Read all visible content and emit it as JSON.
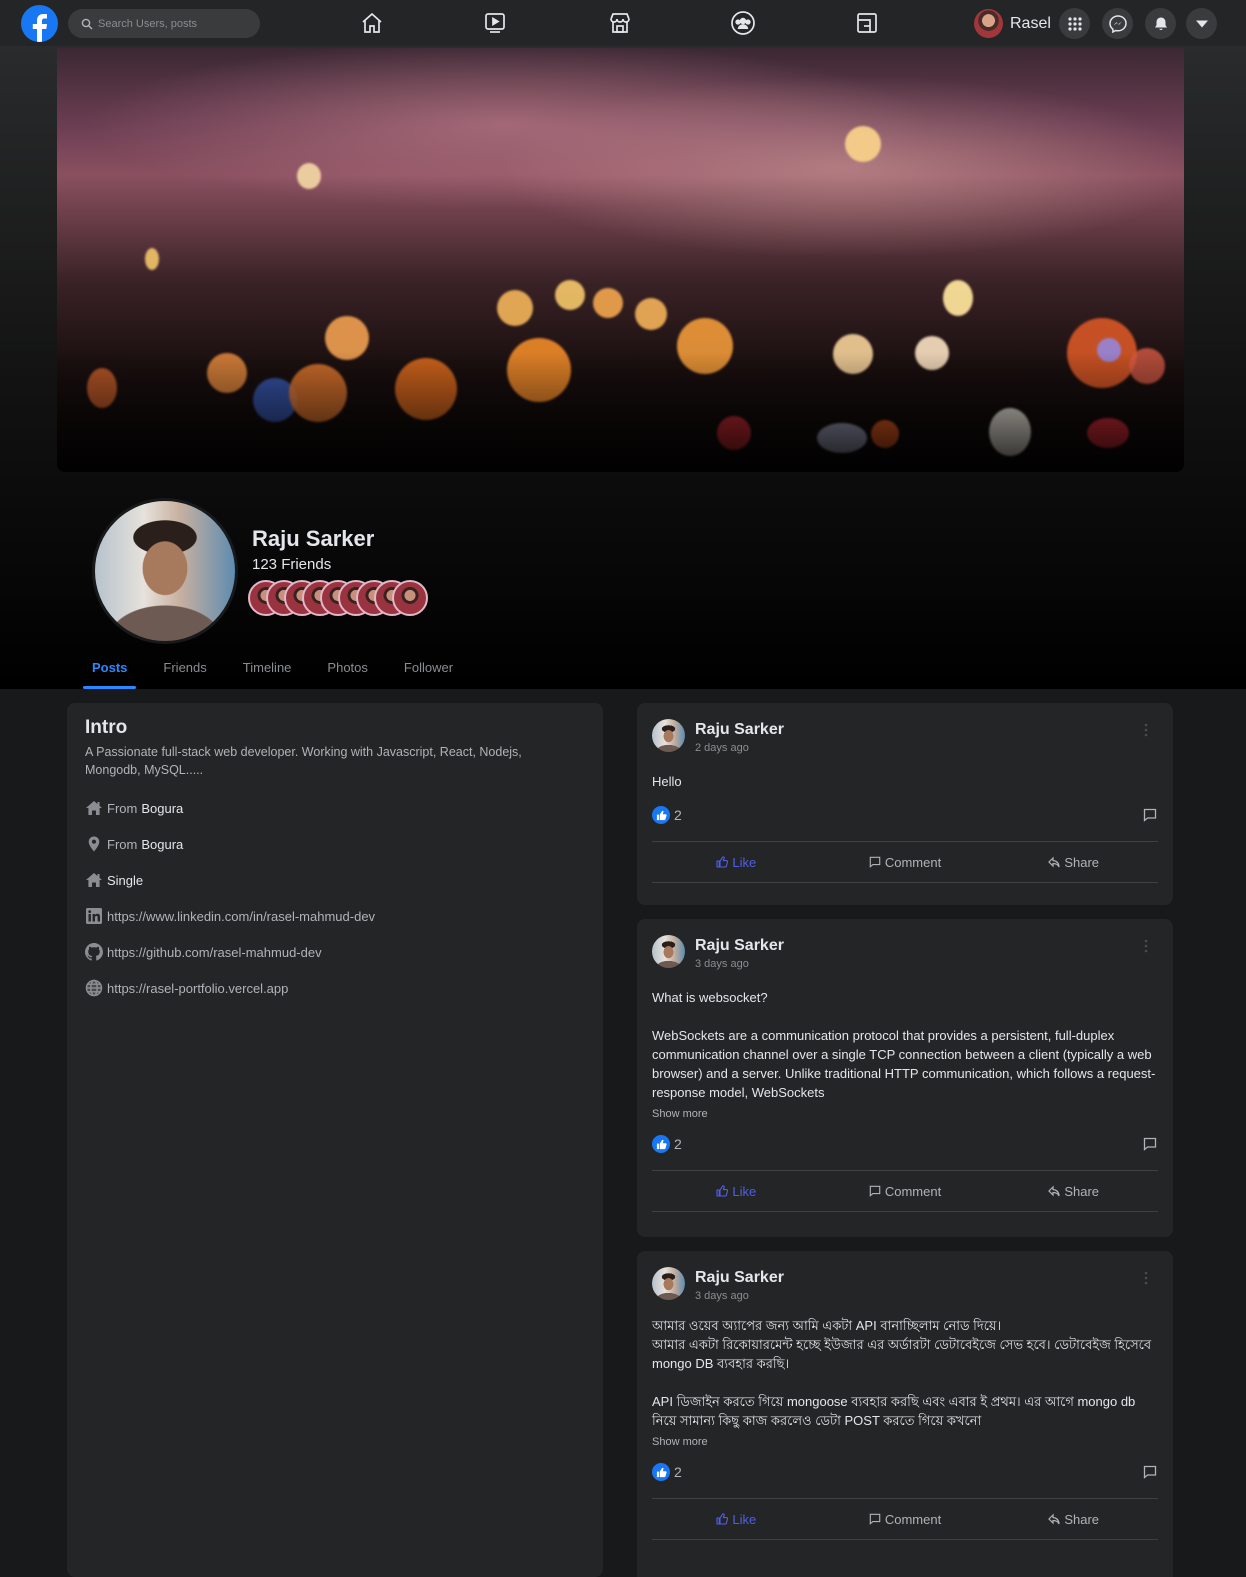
{
  "nav": {
    "search_placeholder": "Search Users, posts",
    "user_name": "Rasel"
  },
  "profile": {
    "name": "Raju Sarker",
    "friends_label": "123 Friends",
    "tabs": [
      "Posts",
      "Friends",
      "Timeline",
      "Photos",
      "Follower"
    ]
  },
  "intro": {
    "title": "Intro",
    "bio": "A Passionate full-stack web developer. Working with Javascript, React, Nodejs, Mongodb, MySQL.....",
    "items": [
      {
        "icon": "home-icon",
        "prefix": "From",
        "value": "Bogura"
      },
      {
        "icon": "location-pin-icon",
        "prefix": "From",
        "value": "Bogura"
      },
      {
        "icon": "home-icon",
        "prefix": "",
        "value": "Single"
      },
      {
        "icon": "linkedin-icon",
        "prefix": "",
        "value": "https://www.linkedin.com/in/rasel-mahmud-dev"
      },
      {
        "icon": "github-icon",
        "prefix": "",
        "value": "https://github.com/rasel-mahmud-dev"
      },
      {
        "icon": "globe-icon",
        "prefix": "",
        "value": "https://rasel-portfolio.vercel.app"
      }
    ]
  },
  "actions": {
    "like": "Like",
    "comment": "Comment",
    "share": "Share"
  },
  "posts": [
    {
      "author": "Raju Sarker",
      "time": "2 days ago",
      "body": "Hello",
      "show_more": "",
      "likes": "2"
    },
    {
      "author": "Raju Sarker",
      "time": "3 days ago",
      "body": "What is websocket?\n\nWebSockets are a communication protocol that provides a persistent, full-duplex communication channel over a single TCP connection between a client (typically a web browser) and a server. Unlike traditional HTTP communication, which follows a request-response model, WebSockets",
      "show_more": "Show more",
      "likes": "2"
    },
    {
      "author": "Raju Sarker",
      "time": "3 days ago",
      "body": "আমার ওয়েব অ্যাপের জন্য আমি একটা API বানাচ্ছিলাম নোড দিয়ে।\nআমার একটা রিকোয়ারমেন্ট হচ্ছে ইউজার এর অর্ডারটা ডেটাবেইজে সেভ হবে। ডেটাবেইজ হিসেবে mongo DB ব্যবহার করছি।\n\nAPI ডিজাইন করতে গিয়ে mongoose ব্যবহার করছি এবং এবার ই প্রথম। এর আগে mongo db নিয়ে সামান্য কিছু কাজ করলেও ডেটা POST করতে গিয়ে কখনো",
      "show_more": "Show more",
      "likes": "2"
    }
  ],
  "colors": {
    "accent": "#2d88ff",
    "facebook_blue": "#1877f2",
    "like_action": "#4e5fe6",
    "card_bg": "#242526",
    "page_bg": "#18191a"
  }
}
